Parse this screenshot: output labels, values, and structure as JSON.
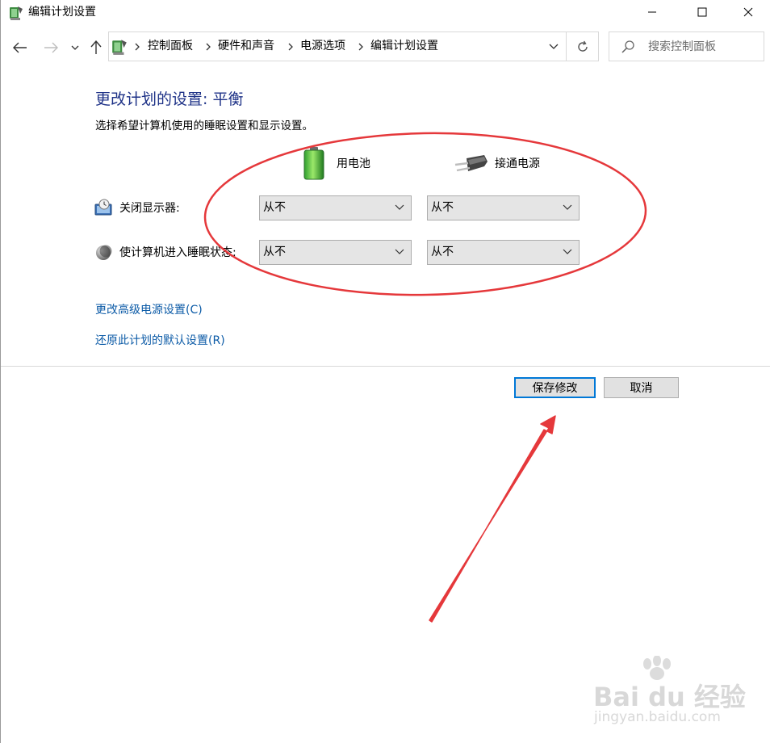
{
  "window": {
    "title": "编辑计划设置"
  },
  "breadcrumb": {
    "items": [
      "控制面板",
      "硬件和声音",
      "电源选项",
      "编辑计划设置"
    ]
  },
  "search": {
    "placeholder": "搜索控制面板"
  },
  "main": {
    "title": "更改计划的设置: 平衡",
    "description": "选择希望计算机使用的睡眠设置和显示设置。",
    "columns": {
      "battery": "用电池",
      "plugged": "接通电源"
    },
    "settings": [
      {
        "label": "关闭显示器:",
        "battery_value": "从不",
        "plugged_value": "从不"
      },
      {
        "label": "使计算机进入睡眠状态:",
        "battery_value": "从不",
        "plugged_value": "从不"
      }
    ],
    "links": {
      "advanced": "更改高级电源设置(C)",
      "restore": "还原此计划的默认设置(R)"
    }
  },
  "footer": {
    "save_label": "保存修改",
    "cancel_label": "取消"
  },
  "watermark": {
    "brand": "Bai du 经验",
    "url": "jingyan.baidu.com"
  },
  "colors": {
    "title_blue": "#1e3287",
    "link_blue": "#0c5ba7",
    "annotation_red": "#e5383b",
    "focus_blue": "#0078d7"
  },
  "icons": {
    "window": "power-options-icon",
    "back": "arrow-left-icon",
    "forward": "arrow-right-icon",
    "recent": "chevron-down-icon",
    "up": "arrow-up-icon",
    "refresh": "refresh-icon",
    "search": "search-icon",
    "battery": "battery-icon",
    "plug": "plug-icon",
    "display": "display-clock-icon",
    "sleep": "moon-icon"
  }
}
